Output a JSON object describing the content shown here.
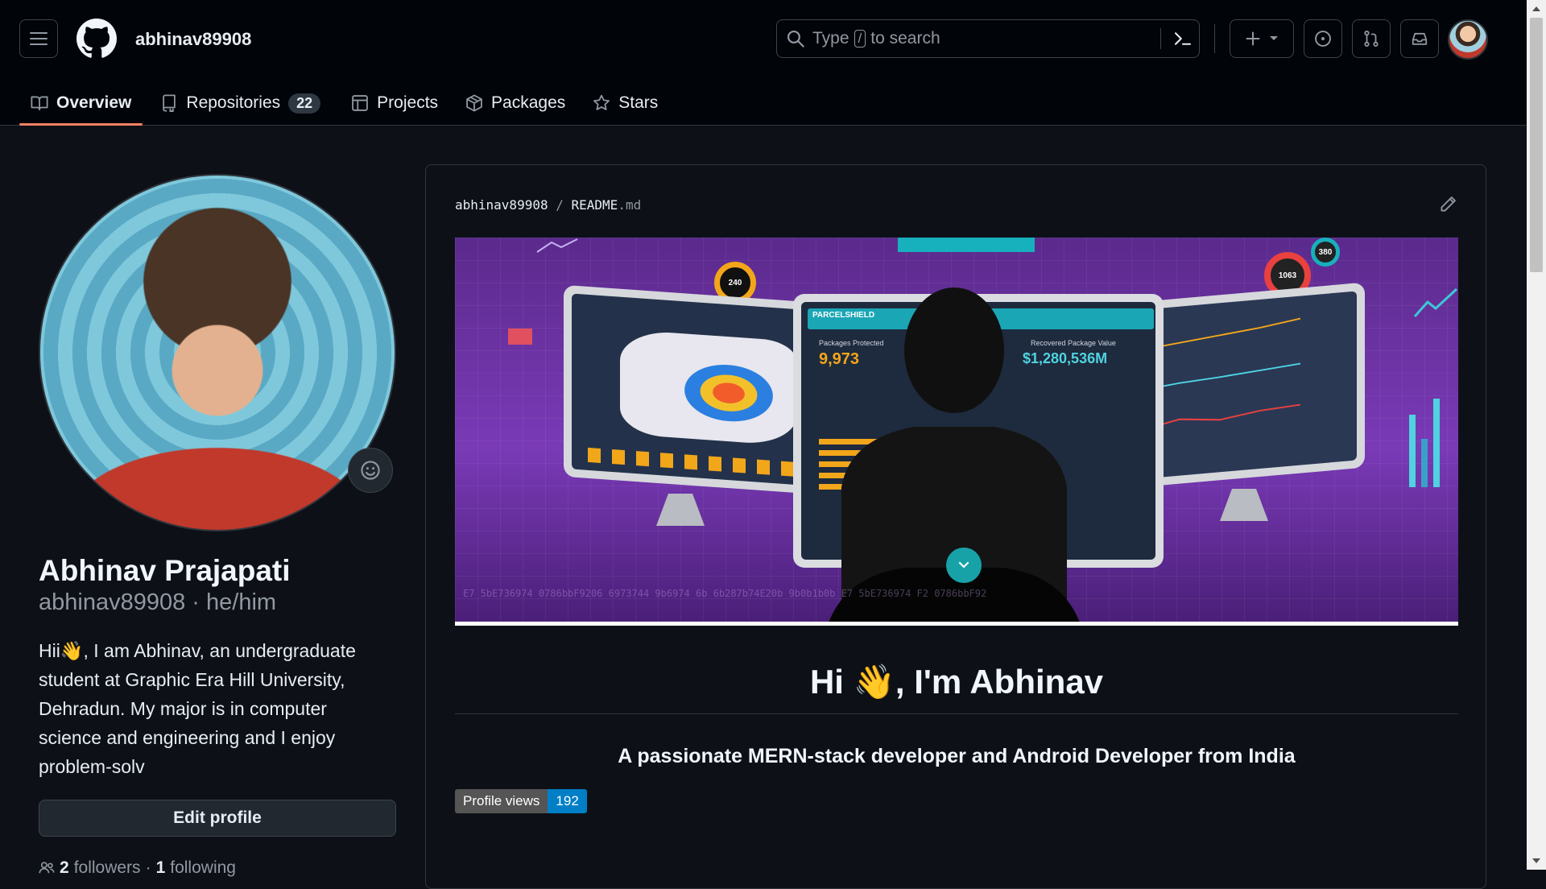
{
  "header": {
    "username": "abhinav89908",
    "search_prefix": "Type",
    "search_key": "/",
    "search_suffix": "to search"
  },
  "tabs": [
    {
      "label": "Overview",
      "icon": "book-icon",
      "active": true
    },
    {
      "label": "Repositories",
      "icon": "repo-icon",
      "count": "22"
    },
    {
      "label": "Projects",
      "icon": "table-icon"
    },
    {
      "label": "Packages",
      "icon": "package-icon"
    },
    {
      "label": "Stars",
      "icon": "star-icon"
    }
  ],
  "profile": {
    "name": "Abhinav Prajapati",
    "handle": "abhinav89908 · he/him",
    "bio": "Hii👋, I am Abhinav, an undergraduate student at Graphic Era Hill University, Dehradun. My major is in computer science and engineering and I enjoy problem-solv",
    "edit_label": "Edit profile",
    "followers_count": "2",
    "followers_label": "followers",
    "following_count": "1",
    "following_label": "following"
  },
  "readme": {
    "owner": "abhinav89908",
    "separator": "/",
    "file": "README",
    "ext": ".md",
    "heading": "Hi 👋, I'm Abhinav",
    "subheading": "A passionate MERN-stack developer and Android Developer from India",
    "badge_label": "Profile views",
    "badge_value": "192"
  },
  "banner": {
    "brand": "PARCELSHIELD",
    "packages_label": "Packages Protected",
    "packages_value": "9,973",
    "recovered_label": "Recovered Package Value",
    "recovered_value": "$1,280,536M",
    "donut_1": "240",
    "donut_2": "1063",
    "donut_3": "380",
    "hex_text": "E7   5bE736974   0786bbF9206        6973744 9b6974   6b        6b287b74E20b   9b0b1b0b   E7   5bE736974   F2 0786bbF92"
  },
  "colors": {
    "bg": "#0d1117",
    "tab_underline": "#f78166",
    "badge_blue": "#007ec6",
    "banner_purple": "#7a3ab7"
  }
}
